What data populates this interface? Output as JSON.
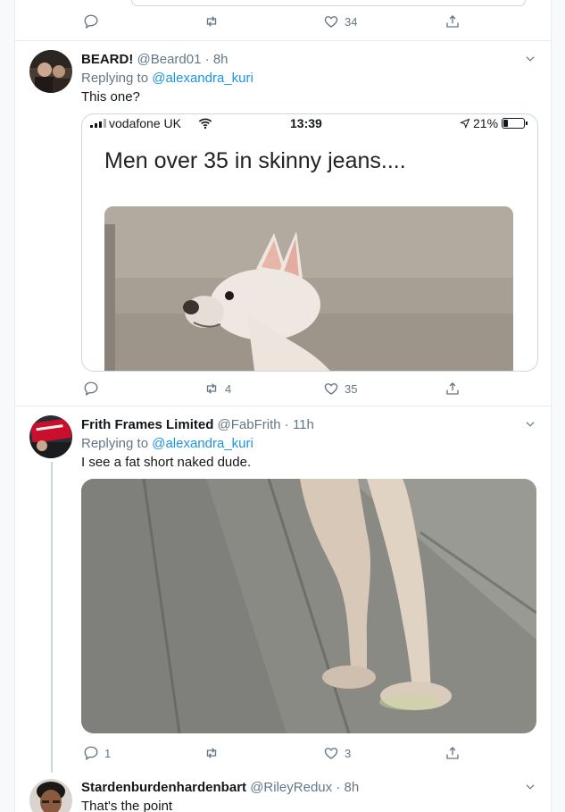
{
  "top_tweet": {
    "like_count": "34"
  },
  "tweets": [
    {
      "name": "BEARD!",
      "handle": "@Beard01",
      "dot": "·",
      "time": "8h",
      "replying_prefix": "Replying to",
      "replying_to": "@alexandra_kuri",
      "text": "This one?",
      "embedded_screenshot": {
        "carrier": "vodafone UK",
        "clock": "13:39",
        "battery": "21%",
        "caption": "Men over 35 in skinny jeans...."
      },
      "reply_count": "",
      "retweet_count": "4",
      "like_count": "35"
    },
    {
      "name": "Frith Frames Limited",
      "handle": "@FabFrith",
      "dot": "·",
      "time": "11h",
      "replying_prefix": "Replying to",
      "replying_to": "@alexandra_kuri",
      "text": "I see a fat short naked dude.",
      "reply_count": "1",
      "retweet_count": "",
      "like_count": "3"
    },
    {
      "name": "Stardenburdenhardenbart",
      "handle": "@RileyRedux",
      "dot": "·",
      "time": "8h",
      "text": "That's the point"
    }
  ],
  "icons": {
    "reply": "reply-icon",
    "retweet": "retweet-icon",
    "like": "heart-icon",
    "share": "share-icon",
    "more": "chevron-down-icon"
  },
  "colors": {
    "mention": "#1b95e0",
    "muted": "#657786",
    "border": "#e6ecf0"
  }
}
